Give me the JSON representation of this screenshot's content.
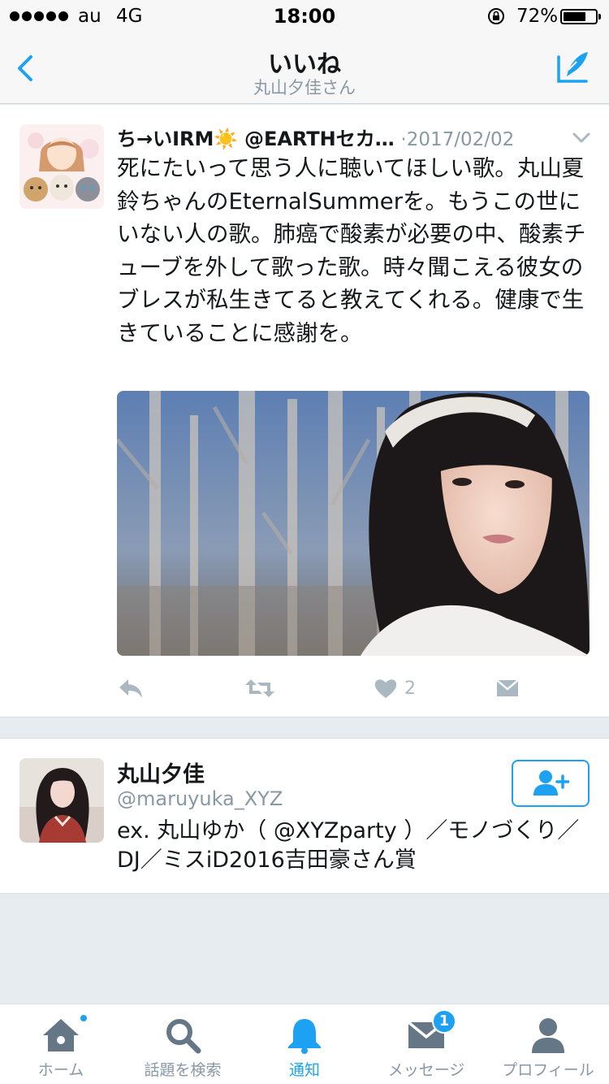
{
  "status_bar": {
    "carrier": "au",
    "network": "4G",
    "time": "18:00",
    "battery_percent_label": "72%",
    "battery_level": 0.72
  },
  "nav": {
    "title": "いいね",
    "subtitle": "丸山夕佳さん",
    "back_icon": "chevron-left-icon",
    "compose_icon": "compose-icon"
  },
  "tweet": {
    "name": "ち→いIRM☀️",
    "handle": "@EARTHセカ…",
    "separator": "·",
    "date": "2017/02/02",
    "text": "死にたいって思う人に聴いてほしい歌。丸山夏鈴ちゃんのEternalSummerを。もうこの世にいない人の歌。肺癌で酸素が必要の中、酸素チューブを外して歌った歌。時々聞こえる彼女のブレスが私生きてると教えてくれる。健康で生きていることに感謝を。",
    "like_count": "2"
  },
  "user": {
    "name": "丸山夕佳",
    "handle": "@maruyuka_XYZ",
    "bio": "ex. 丸山ゆか（ @XYZparty ）／モノづくり／ DJ／ミスiD2016吉田豪さん賞"
  },
  "tabs": [
    {
      "label": "ホーム",
      "icon": "home-icon"
    },
    {
      "label": "話題を検索",
      "icon": "search-icon"
    },
    {
      "label": "通知",
      "icon": "bell-icon"
    },
    {
      "label": "メッセージ",
      "icon": "envelope-icon"
    },
    {
      "label": "プロフィール",
      "icon": "person-icon"
    }
  ],
  "messages_badge": "1",
  "colors": {
    "accent": "#1da1f2",
    "muted": "#8899a6",
    "background": "#e6ecf0"
  }
}
